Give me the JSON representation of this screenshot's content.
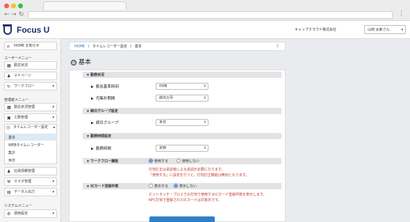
{
  "app": {
    "logo": "Focus U",
    "company": "キャップクラウド株式会社",
    "user": "山田 太郎さん"
  },
  "sidebar": {
    "home": "HOME お知らせ",
    "user_menu": "ユーザーメニュー",
    "user_items": [
      "勤怠状況",
      "マイページ",
      "ワークフロー"
    ],
    "admin_menu": "管理者メニュー",
    "admin_items": [
      "勤怠状況管理",
      "工数管理",
      "タイムレコーダー設定"
    ],
    "sub_items": [
      "基本",
      "WEBタイムレコーダー",
      "集計",
      "休日"
    ],
    "admin_items2": [
      "社員情報管理",
      "マスタ管理",
      "データ入出力"
    ],
    "system_menu": "システムメニュー",
    "system_items": [
      "運用設定"
    ]
  },
  "breadcrumb": {
    "home": "HOME",
    "sep1": "/",
    "settings": "タイムレコーダー設定",
    "sep2": "/",
    "current": "基本",
    "help": "?"
  },
  "page": {
    "title": "基本"
  },
  "sections": {
    "work_status": {
      "title": "勤務状況",
      "rows": [
        {
          "label": "勤怠基準時刻",
          "value": "05時"
        },
        {
          "label": "月集計期間",
          "value": "締日の月"
        }
      ]
    },
    "closing_group": {
      "title": "締日グループ設定",
      "rows": [
        {
          "label": "締日グループ",
          "value": "末日"
        }
      ]
    },
    "working_hours": {
      "title": "勤務時間設定",
      "rows": [
        {
          "label": "勤務時間",
          "value": "定時"
        }
      ]
    },
    "workflow": {
      "title": "ワークフロー機能",
      "opt_on": "使用する",
      "opt_off": "使用しない",
      "selected": "使用する",
      "note1": "打刻訂正は承認者による承認が必要になります。",
      "note2": "「使用する」に設定を行うと、打刻訂正機能は無効となります。"
    },
    "iccard": {
      "title": "ICカード登録件数",
      "opt_show": "表示する",
      "opt_hide": "表示しない",
      "selected": "表示しない",
      "note1": "ピットタッチ・プロ２での打刻で使用するICカード登録件数を表示します。",
      "note2": "NFC打刻で登録されたICカードは対象外です。"
    }
  },
  "colors": {
    "brand": "#1b2f6b",
    "accent": "#2f80c8",
    "note": "#c0392b"
  }
}
